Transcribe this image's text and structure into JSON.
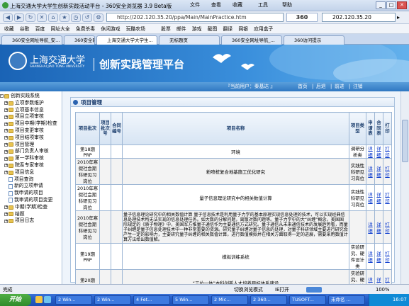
{
  "window": {
    "title": "上海交通大学大学生创新实践活动平台 - 360安全浏览器 3.9 Beta版",
    "menu": [
      "文件",
      "查看",
      "收藏",
      "工具",
      "帮助"
    ]
  },
  "toolbar": {
    "address": "http://202.120.35.20/ppa/Main/MainPractice.htm",
    "brand": "360",
    "search_value": "202.120.35.20"
  },
  "favorites": [
    "收藏",
    "谷歌",
    "百度",
    "网址大全",
    "免费杀毒",
    "休闲游戏",
    "玩酷农场",
    "股票",
    "邮件",
    "游戏",
    "截图",
    "翻译",
    "网银",
    "应用盒子"
  ],
  "tabs": [
    "360安全网址导航_安...",
    "360安全网址导航_安...",
    "上海交通大学大学生...",
    "无标题页",
    "360安全网址导航_...",
    "360访问提示"
  ],
  "banner": {
    "logo_cn": "上海交通大学",
    "logo_en": "SHANGHAI JIAO TONG UNIVERSITY",
    "title": "创新实践管理平台",
    "location": "『当前用户：秦基达 』",
    "links": [
      "首页",
      "后退",
      "前进",
      "注销"
    ]
  },
  "sidebar": {
    "root": "创新实践系统",
    "items": [
      {
        "label": "立项参数维护",
        "kind": "folder",
        "indent": 1
      },
      {
        "label": "立项基本信息",
        "kind": "folder",
        "indent": 1
      },
      {
        "label": "项目立项审核",
        "kind": "folder",
        "indent": 1
      },
      {
        "label": "项目中期(学期)检查",
        "kind": "folder",
        "indent": 1
      },
      {
        "label": "项目变更审核",
        "kind": "folder",
        "indent": 1
      },
      {
        "label": "项目结项审核",
        "kind": "folder",
        "indent": 1
      },
      {
        "label": "项目管理",
        "kind": "folder",
        "indent": 1
      },
      {
        "label": "部门负责人审核",
        "kind": "folder",
        "indent": 1
      },
      {
        "label": "第一学科审核",
        "kind": "folder",
        "indent": 1
      },
      {
        "label": "院系专家审核",
        "kind": "folder",
        "indent": 1
      },
      {
        "label": "项目信息",
        "kind": "folder",
        "indent": 1
      },
      {
        "label": "项目查询",
        "kind": "page",
        "indent": 2
      },
      {
        "label": "新的立项申请",
        "kind": "page",
        "indent": 2
      },
      {
        "label": "我申请的项目",
        "kind": "page",
        "indent": 2
      },
      {
        "label": "我审请的项目变更",
        "kind": "page",
        "indent": 2
      },
      {
        "label": "中期(学期)检查",
        "kind": "folder",
        "indent": 1
      },
      {
        "label": "结题",
        "kind": "folder",
        "indent": 1
      },
      {
        "label": "项目日志",
        "kind": "folder",
        "indent": 1
      }
    ]
  },
  "main": {
    "panel_title": "项目管理",
    "headers": [
      "项目批次",
      "项目批次号",
      "合同编号",
      "项目名称",
      "项目类型",
      "申请表",
      "合同表",
      "打印"
    ],
    "rows": [
      {
        "batch": "第18期PRP",
        "name": "环境",
        "type": "调研分析类",
        "apply": "详细",
        "contract": "详细",
        "print": "打印"
      },
      {
        "batch": "2010年寒假社会期科研见习岗位",
        "name": "粉喷桩复合地基施工优化研究",
        "type": "实践性科研见习岗位",
        "apply": "详细",
        "contract": "详细",
        "print": "打印"
      },
      {
        "batch": "2010年寒假社会期科研见习岗位",
        "name": "量子信息理论研究中的相关数值计算",
        "type": "实践性科研见习岗位",
        "apply": "详细",
        "contract": "详细",
        "print": "打印"
      },
      {
        "batch": "2010年寒假社会期科研见习岗位",
        "name": "量子信息理论研究中的相关数值计算 量子信息技术是利用量子力学的基本原理实现信息处理的技术，可以实现经典信息处理技术所无法实现的信息处理任务。如大数的分解问题，离散对数问题等。量子力学中的大“纠缠”概念，美国国际规定的《质子物理》中，美国军方推量子通信作为主要通信方式研究。量子通信从未来通信技术的发展趋势看，而量子纠缠是量子信息处理技术中一种非常重要的资源。研究量子纠缠对量子信息的处理，对量子科研领域主要进行研究会产生一定的影响力，主要研究量子纠缠的相关数值计算，进行数值模拟并在相关方面取得一定的进展，需要采用数值计算方法给出数值解。",
        "type": "",
        "apply": "详细",
        "contract": "详细",
        "print": "打印"
      },
      {
        "batch": "第19期PRP",
        "name": "模拟训练系统",
        "type": "实验研究、硬件设计类",
        "apply": "详细",
        "contract": "详细",
        "print": "打印"
      },
      {
        "batch": "第20期PRP",
        "name": "“三位一体”本科创新人才培养目标体系建设",
        "type": "实验研究、硬件设计类",
        "apply": "详细",
        "contract": "详细",
        "print": "打印"
      }
    ]
  },
  "status": {
    "left": "完成",
    "mode": "切换浏览模式",
    "ie": "IE打开",
    "zoom": "100%"
  },
  "taskbar": {
    "start": "开始",
    "items": [
      "2 Win...",
      "2 Win...",
      "4 Fet...",
      "5 Win...",
      "2 Mic...",
      "2 360...",
      "TUSOFT...",
      "未命名 ..."
    ],
    "clock": "16:07"
  }
}
